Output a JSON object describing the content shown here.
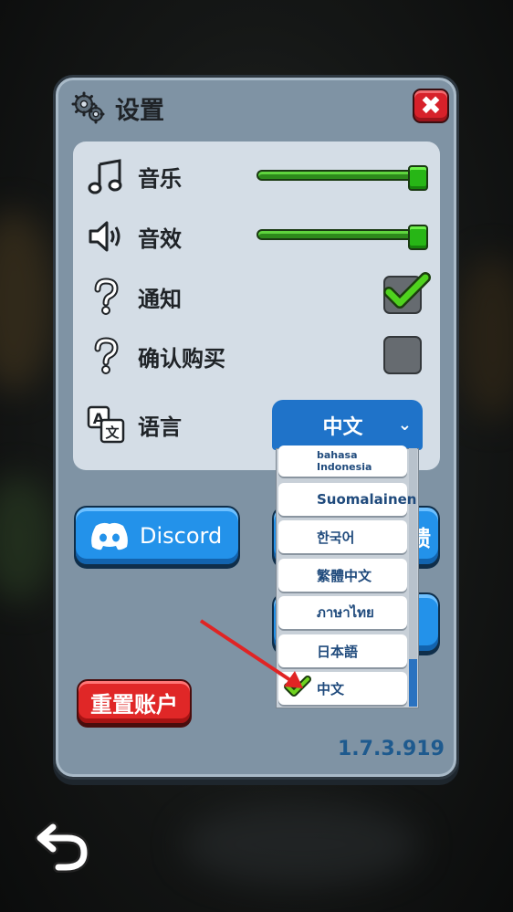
{
  "settings": {
    "title": "设置",
    "close_symbol": "✖",
    "music_label": "音乐",
    "music_volume": 1.0,
    "sfx_label": "音效",
    "sfx_volume": 1.0,
    "notify_label": "通知",
    "notify_checked": true,
    "confirm_label": "确认购买",
    "confirm_checked": false,
    "language_label": "语言",
    "language_value": "中文",
    "language_options": [
      {
        "label": "bahasa Indonesia"
      },
      {
        "label": "Suomalainen"
      },
      {
        "label": "한국어"
      },
      {
        "label": "繁體中文"
      },
      {
        "label": "ภาษาไทย"
      },
      {
        "label": "日本語"
      },
      {
        "label": "中文",
        "selected": true
      }
    ],
    "discord_label": "Discord",
    "right_button_partial": "馈",
    "reset_label": "重置账户",
    "version": "1.7.3.919"
  },
  "icons": {
    "gear": "gear-icon",
    "music": "music-note-icon",
    "sfx": "speaker-icon",
    "help": "question-icon",
    "language": "translate-icon",
    "back": "back-arrow-icon",
    "check": "checkmark-icon"
  },
  "colors": {
    "panel": "#7f93a4",
    "inner": "#d4dde6",
    "accent_blue": "#2392ea",
    "accent_red": "#e02727",
    "slider_green": "#27b616",
    "version_blue": "#1e5a8e"
  }
}
